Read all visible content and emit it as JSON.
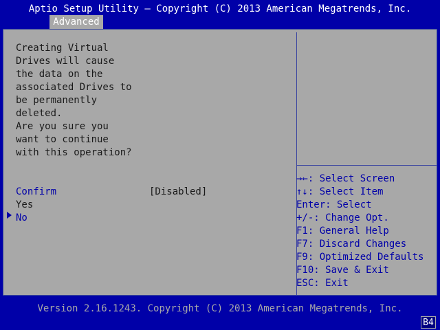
{
  "header": {
    "title": "Aptio Setup Utility – Copyright (C) 2013 American Megatrends, Inc.",
    "active_tab": "Advanced"
  },
  "message": {
    "lines": [
      "Creating Virtual",
      "Drives will cause",
      "the data on the",
      "associated Drives to",
      "be permanently",
      "deleted.",
      "Are you sure you",
      "want to continue",
      "with this operation?"
    ]
  },
  "options": {
    "confirm_label": "Confirm",
    "confirm_value": "[Disabled]",
    "yes_label": "Yes",
    "no_label": "No"
  },
  "help": {
    "lines": [
      "→←: Select Screen",
      "↑↓: Select Item",
      "Enter: Select",
      "+/-: Change Opt.",
      "F1: General Help",
      "F7: Discard Changes",
      "F9: Optimized Defaults",
      "F10: Save & Exit",
      "ESC: Exit"
    ]
  },
  "footer": {
    "version": "Version 2.16.1243. Copyright (C) 2013 American Megatrends, Inc.",
    "post_code": "B4"
  },
  "colors": {
    "background": "#0000a8",
    "panel": "#a8a8a8",
    "highlight_text": "#0000a8",
    "body_text": "#1a1a1a"
  }
}
